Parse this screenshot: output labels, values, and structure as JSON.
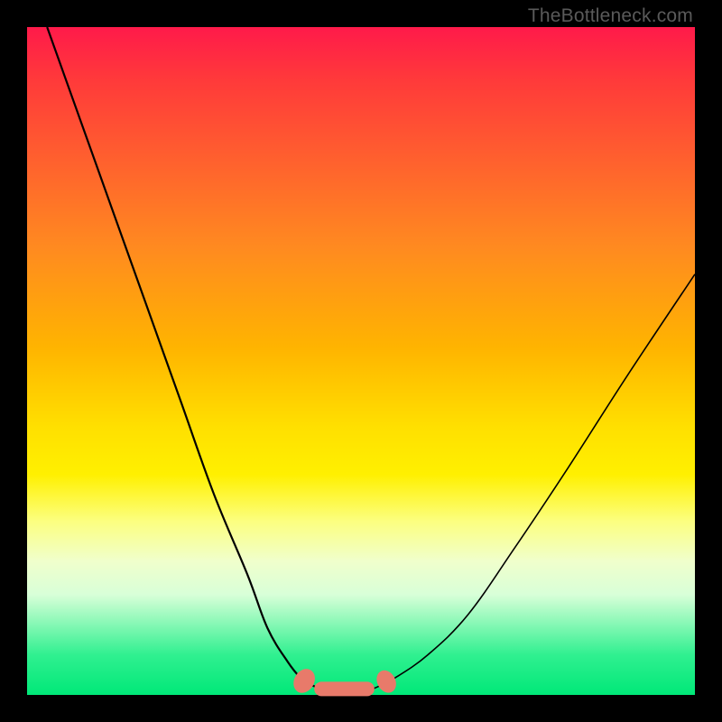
{
  "attribution": "TheBottleneck.com",
  "chart_data": {
    "type": "line",
    "title": "",
    "xlabel": "",
    "ylabel": "",
    "xlim": [
      0,
      100
    ],
    "ylim": [
      0,
      100
    ],
    "series": [
      {
        "name": "left-curve",
        "x": [
          3,
          8,
          13,
          18,
          23,
          28,
          33,
          36,
          39,
          41,
          42.5,
          44
        ],
        "values": [
          100,
          86,
          72,
          58,
          44,
          30,
          18,
          10,
          5,
          2.5,
          1.5,
          1
        ]
      },
      {
        "name": "floor-segment",
        "x": [
          44,
          48,
          52
        ],
        "values": [
          1,
          0.8,
          1
        ]
      },
      {
        "name": "right-curve",
        "x": [
          52,
          55,
          60,
          66,
          73,
          81,
          90,
          100
        ],
        "values": [
          1,
          2.5,
          6,
          12,
          22,
          34,
          48,
          63
        ]
      }
    ],
    "markers": [
      {
        "name": "left-bead",
        "cx": 41.5,
        "cy": 2.1
      },
      {
        "name": "right-bead",
        "cx": 53.8,
        "cy": 2.0
      },
      {
        "name": "floor-bar",
        "x0": 43,
        "x1": 52,
        "y": 0.9
      }
    ]
  }
}
